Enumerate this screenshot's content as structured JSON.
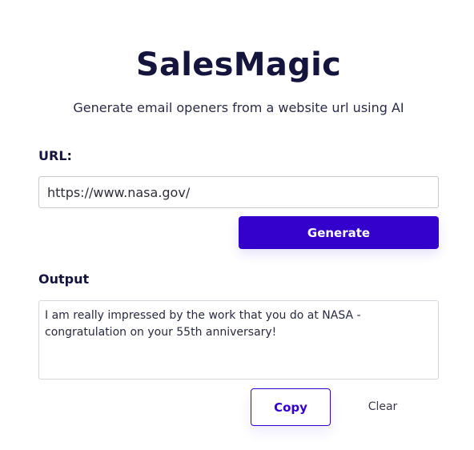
{
  "app": {
    "title": "SalesMagic",
    "subtitle": "Generate email openers from a website url using AI"
  },
  "form": {
    "url_label": "URL:",
    "url_value": "https://www.nasa.gov/",
    "generate_label": "Generate"
  },
  "output": {
    "label": "Output",
    "text": "I am really impressed by the work that you do at NASA - congratulation on your 55th anniversary!",
    "copy_label": "Copy",
    "clear_label": "Clear"
  },
  "colors": {
    "accent": "#3300cc",
    "title_text": "#14143c"
  }
}
